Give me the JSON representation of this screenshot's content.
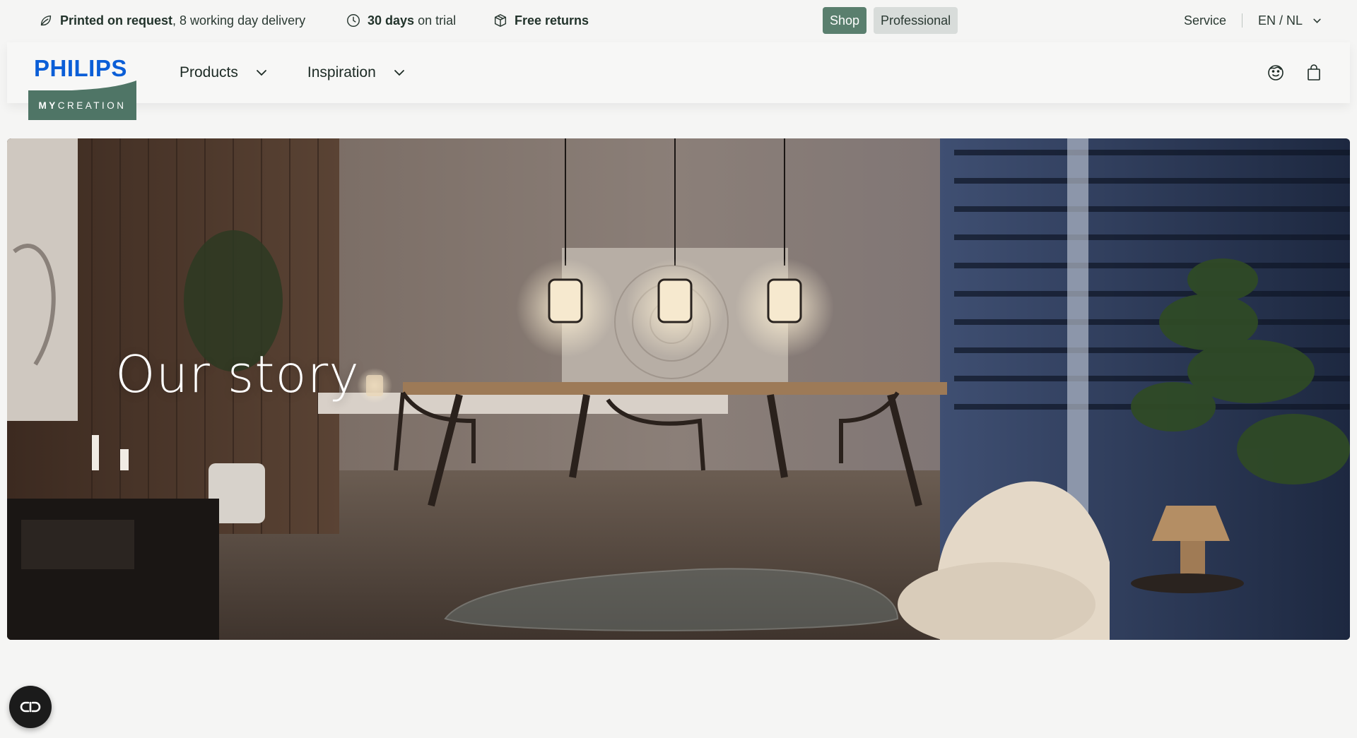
{
  "topbar": {
    "usps": [
      {
        "icon": "leaf-icon",
        "bold": "Printed on request",
        "rest": ", 8 working day delivery"
      },
      {
        "icon": "clock-icon",
        "bold": "30 days",
        "rest": " on trial"
      },
      {
        "icon": "box-icon",
        "bold": "Free returns",
        "rest": ""
      }
    ],
    "segment": {
      "shop": "Shop",
      "professional": "Professional",
      "active": "shop"
    },
    "service_label": "Service",
    "language_label": "EN / NL"
  },
  "header": {
    "logo": {
      "brand": "PHILIPS",
      "sub_bold": "MY",
      "sub_rest": "CREATION"
    },
    "nav": [
      {
        "label": "Products"
      },
      {
        "label": "Inspiration"
      }
    ],
    "icons": [
      "account-icon",
      "bag-icon"
    ]
  },
  "hero": {
    "title": "Our story",
    "image_label": "hero-image"
  },
  "fab": {
    "icon": "accessibility-icon"
  },
  "colors": {
    "accent_green": "#5a7f6e",
    "logo_blue": "#0b5ed7",
    "badge_green": "#4f7566",
    "page_bg": "#f5f5f4"
  }
}
